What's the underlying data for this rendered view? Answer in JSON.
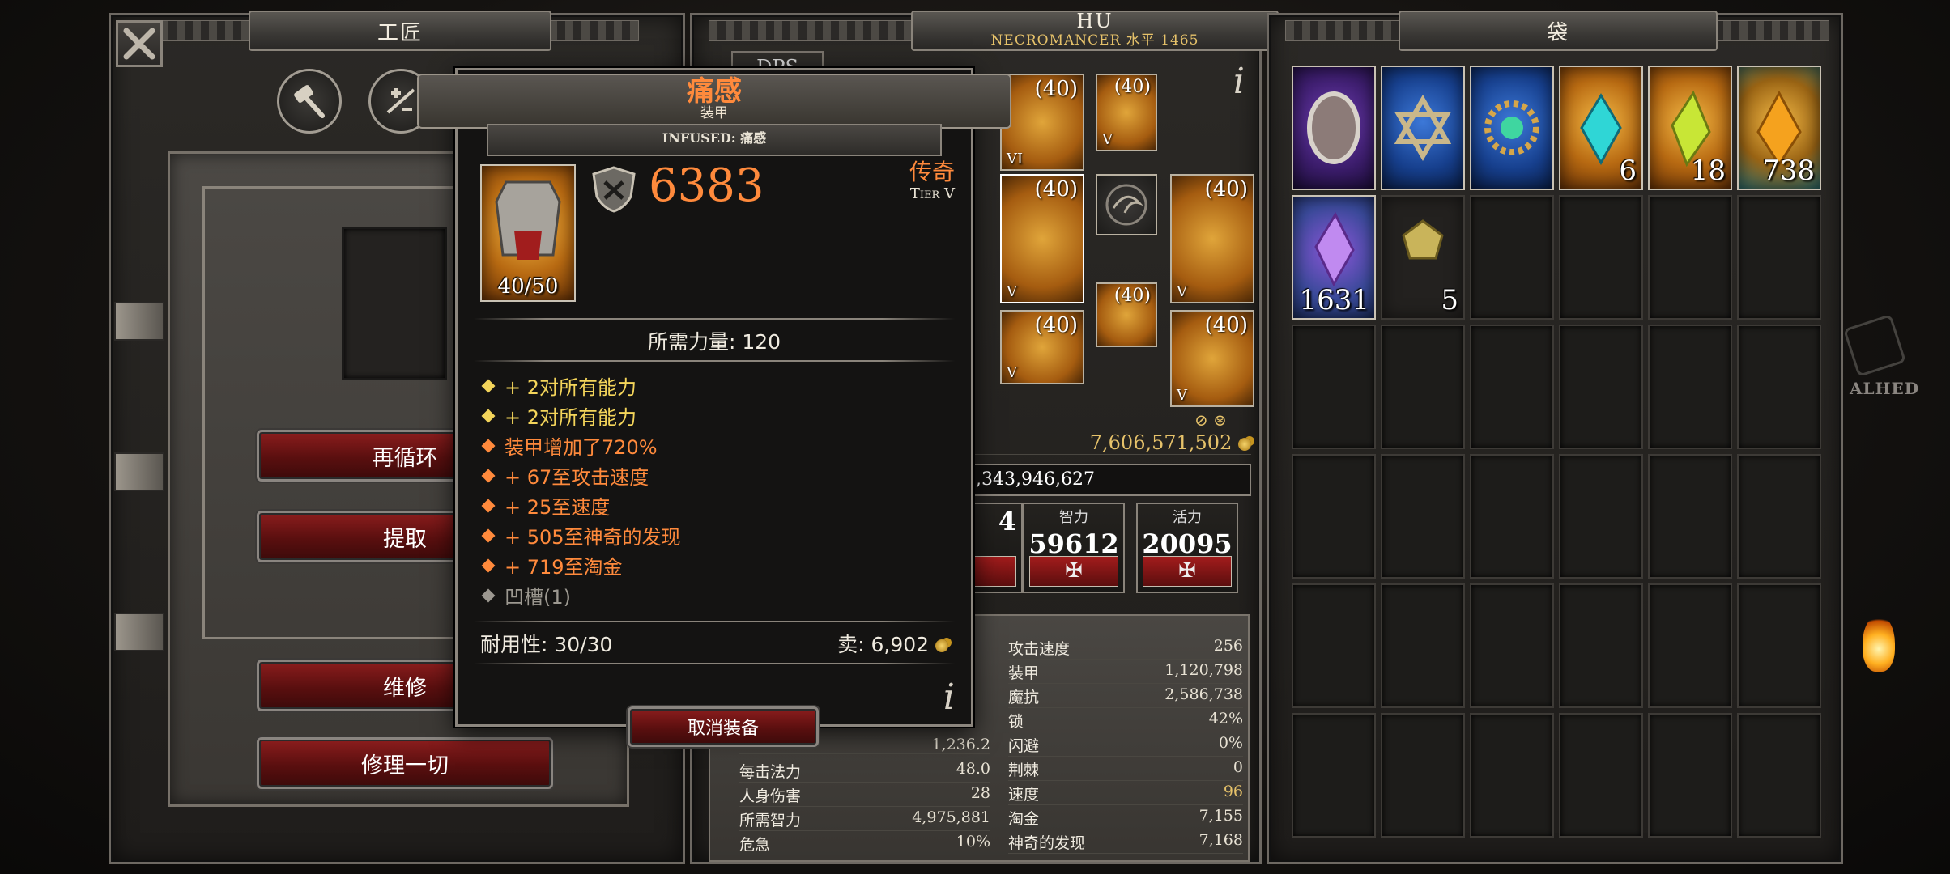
{
  "crafting": {
    "title": "工匠",
    "buttons": [
      "再循环",
      "提取",
      "维修",
      "修理一切"
    ]
  },
  "character": {
    "name": "HU",
    "class_level": "NECROMANCER 水平 1465",
    "dps_tab": "DPS",
    "gold": "7,606,571,502",
    "experience": "126,343,946,627",
    "attributes": [
      {
        "label": "",
        "value": "4"
      },
      {
        "label": "智力",
        "value": "59612"
      },
      {
        "label": "活力",
        "value": "20095"
      }
    ],
    "gear_levels": [
      "(40)",
      "(40)",
      "(40)",
      "(40)",
      "(40)",
      "(40)",
      "(40)"
    ],
    "gear_tiers": [
      "VI",
      "V",
      "V",
      "V",
      "V",
      "V",
      "V"
    ],
    "stats_left": [
      {
        "name": "",
        "value": "1,236.2"
      },
      {
        "name": "每击法力",
        "value": "48.0"
      },
      {
        "name": "人身伤害",
        "value": "28"
      },
      {
        "name": "所需智力",
        "value": "4,975,881"
      },
      {
        "name": "危急",
        "value": "10%"
      }
    ],
    "stats_right": [
      {
        "name": "攻击速度",
        "value": "256"
      },
      {
        "name": "装甲",
        "value": "1,120,798"
      },
      {
        "name": "魔抗",
        "value": "2,586,738"
      },
      {
        "name": "锁",
        "value": "42%"
      },
      {
        "name": "闪避",
        "value": "0%"
      },
      {
        "name": "荆棘",
        "value": "0"
      },
      {
        "name": "速度",
        "value": "96"
      },
      {
        "name": "淘金",
        "value": "7,155"
      },
      {
        "name": "神奇的发现",
        "value": "7,168"
      }
    ]
  },
  "bag": {
    "title": "袋",
    "quantities": [
      "6",
      "18",
      "738",
      "1631",
      "5"
    ]
  },
  "tooltip": {
    "name": "痛感",
    "type": "装甲",
    "infused": "INFUSED: 痛感",
    "armor_value": "6383",
    "rarity": "传奇",
    "tier": "Tier V",
    "upgrade": "40/50",
    "requirement": "所需力量: 120",
    "affixes": [
      {
        "text": "+ 2对所有能力",
        "color": "#f3d45a"
      },
      {
        "text": "+ 2对所有能力",
        "color": "#f3d45a"
      },
      {
        "text": "装甲增加了720%",
        "color": "#ff8a3c"
      },
      {
        "text": "+ 67至攻击速度",
        "color": "#ff8a3c"
      },
      {
        "text": "+ 25至速度",
        "color": "#ff8a3c"
      },
      {
        "text": "+ 505至神奇的发现",
        "color": "#ff8a3c"
      },
      {
        "text": "+ 719至淘金",
        "color": "#ff8a3c"
      },
      {
        "text": "凹槽(1)",
        "color": "#9c9890"
      }
    ],
    "durability": "耐用性: 30/30",
    "sell": "卖: 6,902",
    "unequip": "取消装备",
    "info_glyph": "i"
  },
  "overlay": {
    "right_text": "ALHED"
  },
  "colors": {
    "legendary": "#ff8a3c",
    "accent_gold": "#e6c26a"
  }
}
